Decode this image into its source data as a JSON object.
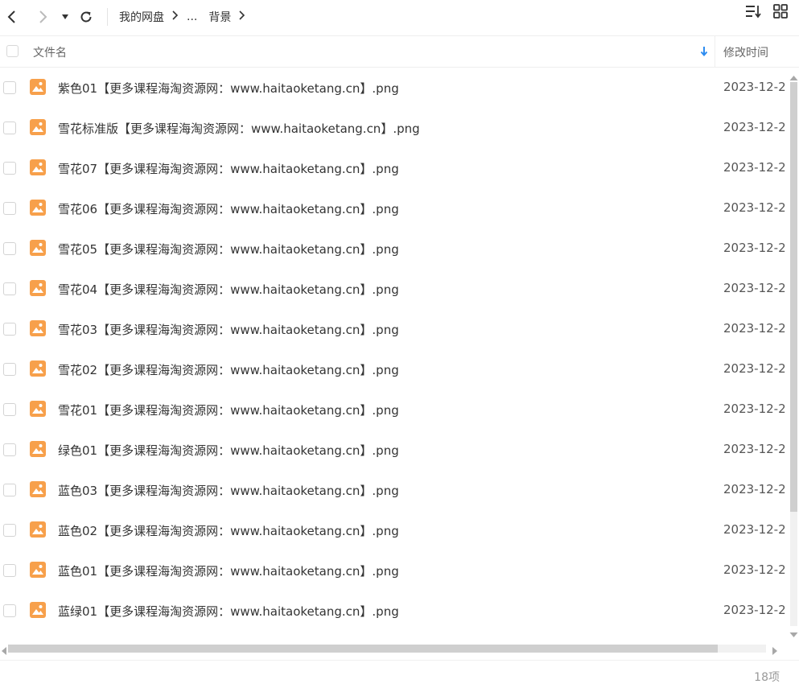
{
  "toolbar": {
    "breadcrumb": [
      "我的网盘",
      "...",
      "背景"
    ]
  },
  "header": {
    "name_label": "文件名",
    "time_label": "修改时间"
  },
  "files": [
    {
      "name": "紫色01【更多课程海淘资源网：www.haitaoketang.cn】.png",
      "time": "2023-12-2"
    },
    {
      "name": "雪花标准版【更多课程海淘资源网：www.haitaoketang.cn】.png",
      "time": "2023-12-2"
    },
    {
      "name": "雪花07【更多课程海淘资源网：www.haitaoketang.cn】.png",
      "time": "2023-12-2"
    },
    {
      "name": "雪花06【更多课程海淘资源网：www.haitaoketang.cn】.png",
      "time": "2023-12-2"
    },
    {
      "name": "雪花05【更多课程海淘资源网：www.haitaoketang.cn】.png",
      "time": "2023-12-2"
    },
    {
      "name": "雪花04【更多课程海淘资源网：www.haitaoketang.cn】.png",
      "time": "2023-12-2"
    },
    {
      "name": "雪花03【更多课程海淘资源网：www.haitaoketang.cn】.png",
      "time": "2023-12-2"
    },
    {
      "name": "雪花02【更多课程海淘资源网：www.haitaoketang.cn】.png",
      "time": "2023-12-2"
    },
    {
      "name": "雪花01【更多课程海淘资源网：www.haitaoketang.cn】.png",
      "time": "2023-12-2"
    },
    {
      "name": "绿色01【更多课程海淘资源网：www.haitaoketang.cn】.png",
      "time": "2023-12-2"
    },
    {
      "name": "蓝色03【更多课程海淘资源网：www.haitaoketang.cn】.png",
      "time": "2023-12-2"
    },
    {
      "name": "蓝色02【更多课程海淘资源网：www.haitaoketang.cn】.png",
      "time": "2023-12-2"
    },
    {
      "name": "蓝色01【更多课程海淘资源网：www.haitaoketang.cn】.png",
      "time": "2023-12-2"
    },
    {
      "name": "蓝绿01【更多课程海淘资源网：www.haitaoketang.cn】.png",
      "time": "2023-12-2"
    }
  ],
  "status": {
    "count": "18项"
  },
  "colors": {
    "file_icon": "#f7a04b",
    "sort_arrow": "#2d8cf0"
  },
  "icons": {
    "back": "chevron-left-icon",
    "forward": "chevron-right-icon",
    "history": "caret-down-icon",
    "refresh": "refresh-icon",
    "sort": "sort-icon",
    "grid": "grid-view-icon",
    "file": "image-file-icon"
  }
}
